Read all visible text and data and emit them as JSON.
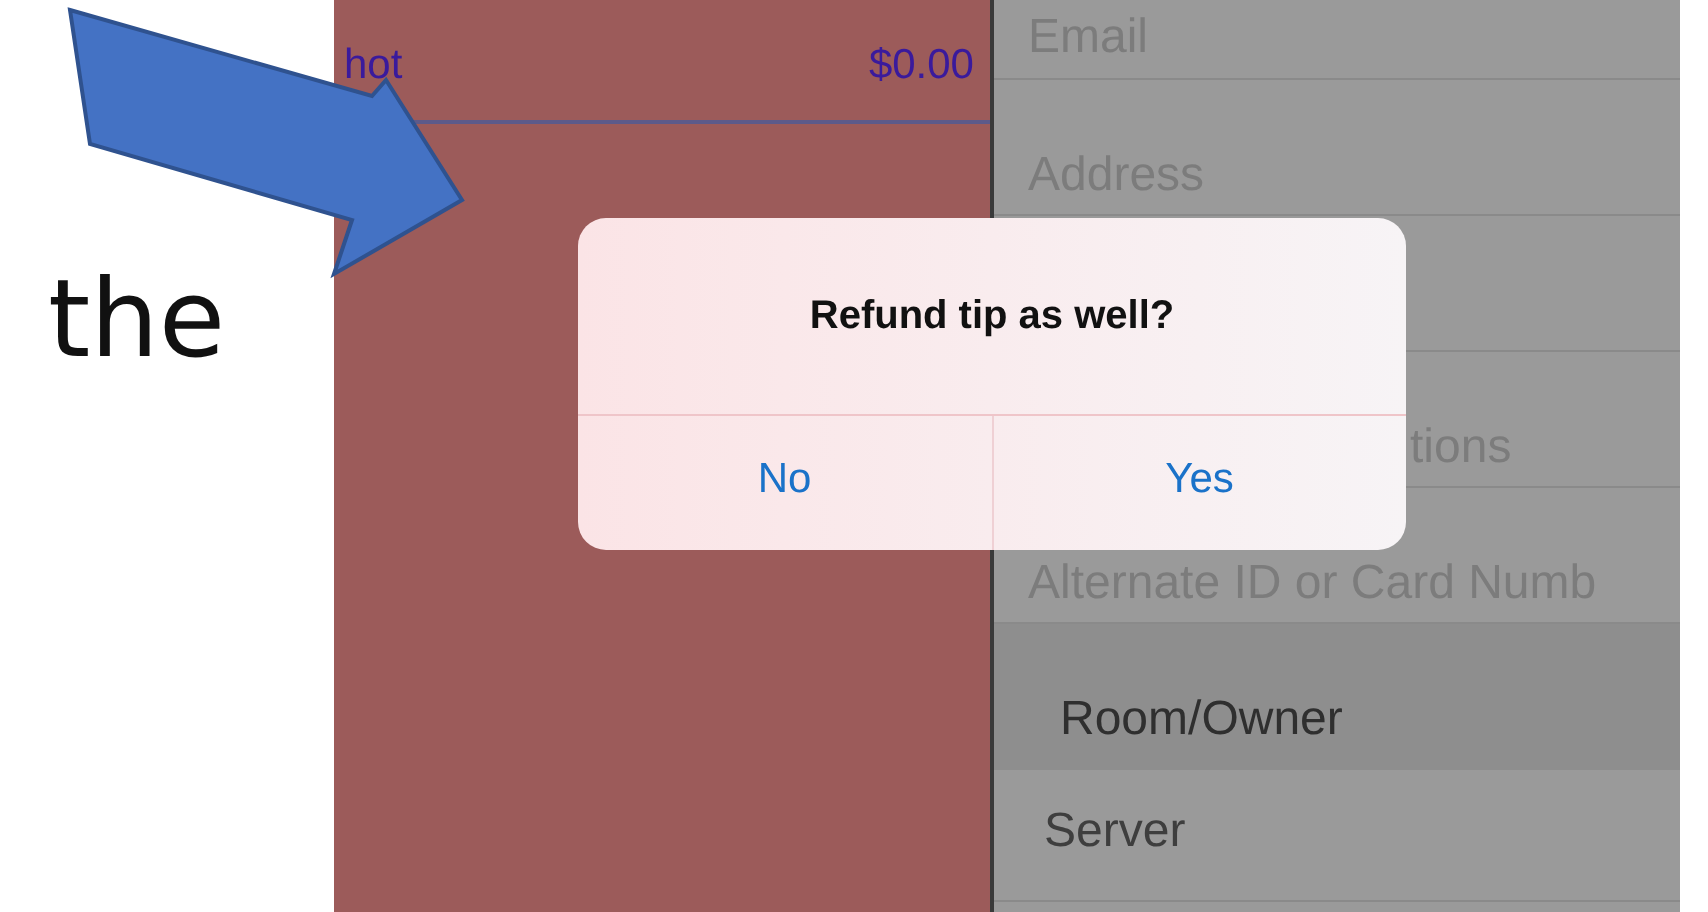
{
  "slide_text": "the",
  "order_panel": {
    "items": [
      {
        "name": "hot",
        "price": "$0.00"
      }
    ]
  },
  "customer_form": {
    "rows": [
      {
        "kind": "field",
        "placeholder": "Email"
      },
      {
        "kind": "field",
        "placeholder": "Address"
      },
      {
        "kind": "covered"
      },
      {
        "kind": "partial",
        "placeholder": "tions"
      },
      {
        "kind": "field",
        "placeholder": "Alternate ID or Card Numb"
      },
      {
        "kind": "section",
        "label": "Room/Owner"
      },
      {
        "kind": "row",
        "label": "Server"
      }
    ]
  },
  "alert": {
    "title": "Refund tip as well?",
    "buttons": [
      "No",
      "Yes"
    ]
  }
}
